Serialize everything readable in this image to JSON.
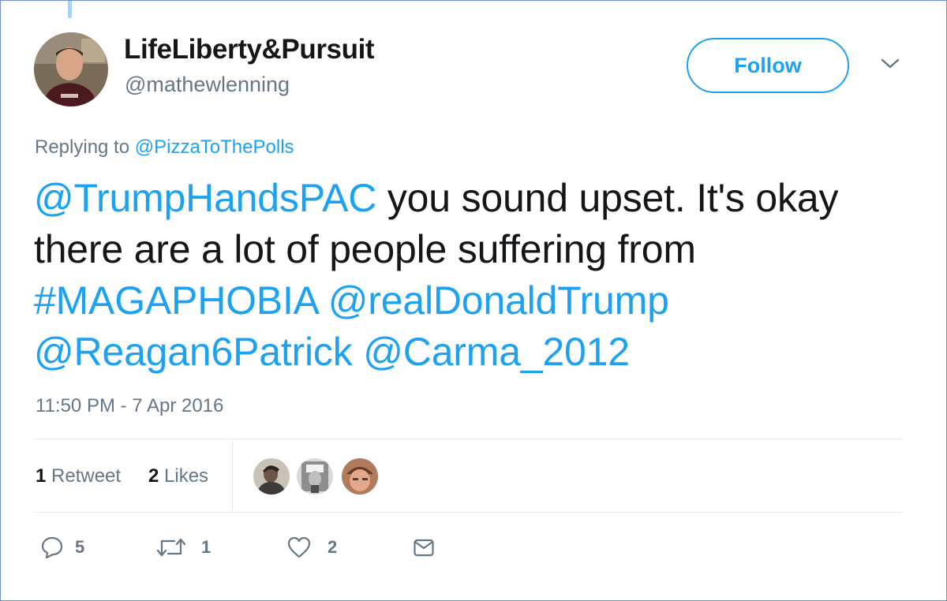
{
  "user": {
    "display_name": "LifeLiberty&Pursuit",
    "handle": "@mathewlenning"
  },
  "follow_button": {
    "label": "Follow"
  },
  "reply_context": {
    "prefix": "Replying to",
    "target": "@PizzaToThePolls"
  },
  "tweet": {
    "mention_1": "@TrumpHandsPAC",
    "text_1": " you sound upset. It's okay there are a lot of people suffering from ",
    "hashtag": "#MAGAPHOBIA",
    "space_1": " ",
    "mention_2": "@realDonaldTrump",
    "space_2": " ",
    "mention_3": "@Reagan6Patrick",
    "space_3": " ",
    "mention_4": "@Carma_2012"
  },
  "timestamp": "11:50 PM - 7 Apr 2016",
  "stats": {
    "retweets_count": "1",
    "retweets_label": "Retweet",
    "likes_count": "2",
    "likes_label": "Likes"
  },
  "actions": {
    "reply_count": "5",
    "retweet_count": "1",
    "like_count": "2"
  },
  "icons": [
    "chevron-down-icon",
    "reply-icon",
    "retweet-icon",
    "heart-icon",
    "mail-icon"
  ],
  "colors": {
    "link_blue": "#1da1f2",
    "text_dark": "#14171a",
    "text_gray": "#657786",
    "divider": "#e6ecf0"
  }
}
